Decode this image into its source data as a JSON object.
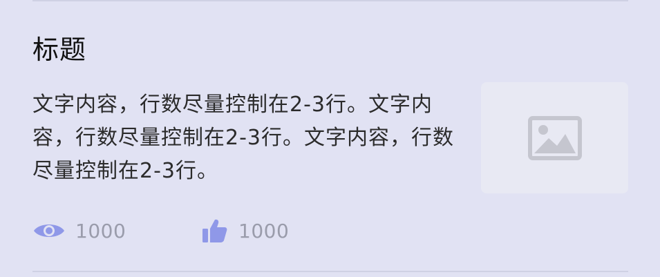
{
  "article": {
    "title": "标题",
    "content": "文字内容，行数尽量控制在2-3行。文字内容，行数尽量控制在2-3行。文字内容，行数尽量控制在2-3行。",
    "thumbnail_icon": "image-placeholder-icon",
    "stats": {
      "views_icon": "eye-icon",
      "views": "1000",
      "likes_icon": "thumbs-up-icon",
      "likes": "1000"
    }
  },
  "colors": {
    "background": "#e1e2f3",
    "accent": "#8f98e8",
    "muted_text": "#9a9cab",
    "placeholder_icon": "#c5c6cf"
  }
}
